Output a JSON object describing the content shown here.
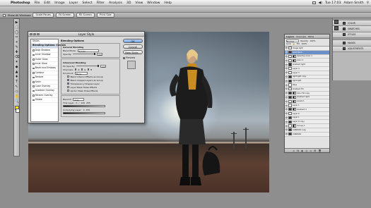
{
  "menubar": {
    "app": "Photoshop",
    "items": [
      "File",
      "Edit",
      "Image",
      "Layer",
      "Select",
      "Filter",
      "Analysis",
      "3D",
      "View",
      "Window",
      "Help"
    ],
    "clock": "Tue 17:03",
    "user": "Adam Smith"
  },
  "optionsbar": {
    "checkbox_label": "Show All Windows",
    "buttons": [
      "Scale Panes",
      "Fit Screen",
      "Fill Screen",
      "Print Size"
    ],
    "workspace": "ESSENTIALS"
  },
  "tools": [
    "▶",
    "⬚",
    "◯",
    "✂",
    "⌖",
    "✎",
    "✚",
    "⌫",
    "✦",
    "◆",
    "▲",
    "♦",
    "T",
    "↖",
    "▭",
    "✋",
    "🔍"
  ],
  "dialog": {
    "title": "Layer Style",
    "styles": [
      {
        "label": "Styles",
        "checkbox": false,
        "selected": false
      },
      {
        "label": "Blending Options: Custom",
        "checkbox": false,
        "selected": true
      },
      {
        "label": "Drop Shadow",
        "checkbox": true,
        "selected": false
      },
      {
        "label": "Inner Shadow",
        "checkbox": true,
        "selected": false
      },
      {
        "label": "Outer Glow",
        "checkbox": true,
        "selected": false
      },
      {
        "label": "Inner Glow",
        "checkbox": true,
        "selected": false
      },
      {
        "label": "Bevel and Emboss",
        "checkbox": true,
        "selected": false
      },
      {
        "label": "Contour",
        "checkbox": true,
        "selected": false
      },
      {
        "label": "Texture",
        "checkbox": true,
        "selected": false
      },
      {
        "label": "Satin",
        "checkbox": true,
        "selected": false
      },
      {
        "label": "Color Overlay",
        "checkbox": true,
        "selected": false
      },
      {
        "label": "Gradient Overlay",
        "checkbox": true,
        "selected": false
      },
      {
        "label": "Pattern Overlay",
        "checkbox": true,
        "selected": false
      },
      {
        "label": "Stroke",
        "checkbox": true,
        "selected": false
      }
    ],
    "blending": {
      "heading": "Blending Options",
      "general": "General Blending",
      "blend_mode_label": "Blend Mode:",
      "blend_mode_value": "Screen",
      "opacity_label": "Opacity:",
      "opacity_value": "100",
      "advanced": "Advanced Blending",
      "fill_label": "Fill Opacity:",
      "fill_value": "100",
      "channels_label": "Channels:",
      "channels": [
        "R",
        "G",
        "B"
      ],
      "knockout_label": "Knockout:",
      "knockout_value": "None",
      "options": [
        {
          "label": "Blend Interior Effects as Group",
          "checked": false
        },
        {
          "label": "Blend Clipped Layers as Group",
          "checked": true
        },
        {
          "label": "Transparency Shapes Layer",
          "checked": true
        },
        {
          "label": "Layer Mask Hides Effects",
          "checked": false
        },
        {
          "label": "Vector Mask Hides Effects",
          "checked": false
        }
      ],
      "blend_if_label": "Blend If:",
      "blend_if_value": "Gray",
      "this_layer_label": "This Layer:",
      "this_layer_values": [
        "0",
        "/",
        "129",
        "255"
      ],
      "underlying_label": "Underlying Layer:",
      "underlying_values": [
        "0",
        "255"
      ]
    },
    "buttons": {
      "ok": "OK",
      "cancel": "Cancel",
      "new_style": "New Style...",
      "preview": "Preview"
    }
  },
  "layers_panel": {
    "tabs": [
      "Layers",
      "Channels",
      "Paths"
    ],
    "mode": "Normal",
    "opacity_label": "Opacity:",
    "opacity_value": "100%",
    "lock_label": "Lock:",
    "fill_label": "Fill:",
    "fill_value": "100%",
    "rows": [
      {
        "name": "Image light",
        "selected": false,
        "thumb": "light",
        "mask": false
      },
      {
        "name": "Solid Back...",
        "selected": true,
        "thumb": "dark",
        "mask": false
      },
      {
        "name": "Selective Color 1",
        "selected": false,
        "thumb": "light",
        "mask": true
      },
      {
        "name": "Color 1",
        "selected": false,
        "thumb": "light",
        "mask": true
      },
      {
        "name": "Gradient light",
        "selected": false,
        "thumb": "dark",
        "mask": false
      },
      {
        "name": "Layer 4",
        "selected": false,
        "thumb": "light",
        "mask": false
      },
      {
        "name": "Layer 3",
        "selected": false,
        "thumb": "light",
        "mask": false
      },
      {
        "name": "light light copy",
        "selected": false,
        "thumb": "dark",
        "mask": false
      },
      {
        "name": "light light",
        "selected": false,
        "thumb": "dark",
        "mask": false
      },
      {
        "name": "Rays",
        "selected": false,
        "thumb": "light",
        "mask": false
      },
      {
        "name": "Gradient Fill",
        "selected": false,
        "thumb": "light",
        "mask": false
      },
      {
        "name": "Color Fill copy",
        "selected": false,
        "thumb": "dark",
        "mask": true
      },
      {
        "name": "Gradient light",
        "selected": false,
        "thumb": "dark",
        "mask": true
      },
      {
        "name": "Levels 1",
        "selected": false,
        "thumb": "light",
        "mask": true
      },
      {
        "name": "Layer 1",
        "selected": false,
        "thumb": "light",
        "mask": false
      },
      {
        "name": "Gradient 3",
        "selected": false,
        "thumb": "dark",
        "mask": true
      },
      {
        "name": "Layer 0",
        "selected": false,
        "thumb": "light",
        "mask": false
      },
      {
        "name": "Layer 1",
        "selected": false,
        "thumb": "dark",
        "mask": false
      },
      {
        "name": "Layer 0 copy",
        "selected": false,
        "thumb": "dark",
        "mask": false
      },
      {
        "name": "Curves 1",
        "selected": false,
        "thumb": "light",
        "mask": true
      },
      {
        "name": "CAB6049 copy",
        "selected": false,
        "thumb": "dark",
        "mask": false
      },
      {
        "name": "CAB6049",
        "selected": false,
        "thumb": "dark",
        "mask": false
      }
    ],
    "footer_icons": [
      "∞",
      "fx",
      "◐",
      "◎",
      "▭",
      "⊞",
      "🗑"
    ]
  },
  "dock": {
    "items": [
      {
        "label": "COLOR",
        "icon": "color-icon"
      },
      {
        "label": "SWATCHES",
        "icon": "swatches-icon"
      },
      {
        "label": "STYLES",
        "icon": "styles-icon"
      },
      {
        "label": "MASKS",
        "icon": "masks-icon"
      },
      {
        "label": "ADJUSTMENTS",
        "icon": "adjustments-icon"
      }
    ]
  },
  "colors": {
    "foreground": "#ffe600",
    "background": "#ffffff",
    "selection": "#6b8fc7"
  }
}
